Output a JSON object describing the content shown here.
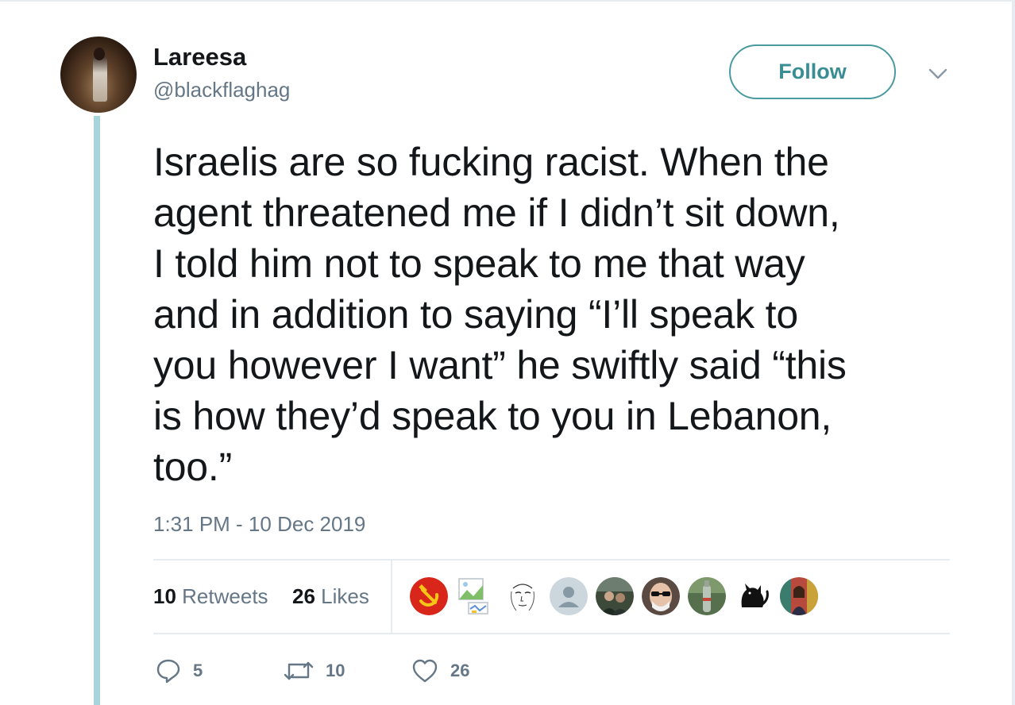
{
  "user": {
    "name": "Lareesa",
    "handle": "@blackflaghag"
  },
  "follow_label": "Follow",
  "tweet": {
    "lines": [
      "Israelis are so fucking racist. When the",
      "agent threatened me if I didn’t sit down,",
      "I told him not to speak to me that way",
      "and in addition to saying “I’ll speak to",
      "you however I want” he swiftly said “this",
      "is how they’d speak to you in Lebanon,",
      "too.”"
    ],
    "timestamp": "1:31 PM - 10 Dec 2019"
  },
  "stats": {
    "retweets_count": "10",
    "retweets_label": "Retweets",
    "likes_count": "26",
    "likes_label": "Likes"
  },
  "likers": [
    {
      "icon": "hammer-sickle-avatar"
    },
    {
      "icon": "broken-image-avatar"
    },
    {
      "icon": "sketch-face-avatar"
    },
    {
      "icon": "default-person-avatar"
    },
    {
      "icon": "two-people-photo-avatar"
    },
    {
      "icon": "man-sunglasses-avatar"
    },
    {
      "icon": "bottle-photo-avatar"
    },
    {
      "icon": "black-cat-avatar"
    },
    {
      "icon": "woman-photo-avatar"
    }
  ],
  "actions": {
    "reply_count": "5",
    "retweet_count": "10",
    "like_count": "26"
  },
  "colors": {
    "accent": "#4a9aa0",
    "thread_line": "#a8d5dc",
    "muted_text": "#657786",
    "divider": "#e6ecf0"
  }
}
